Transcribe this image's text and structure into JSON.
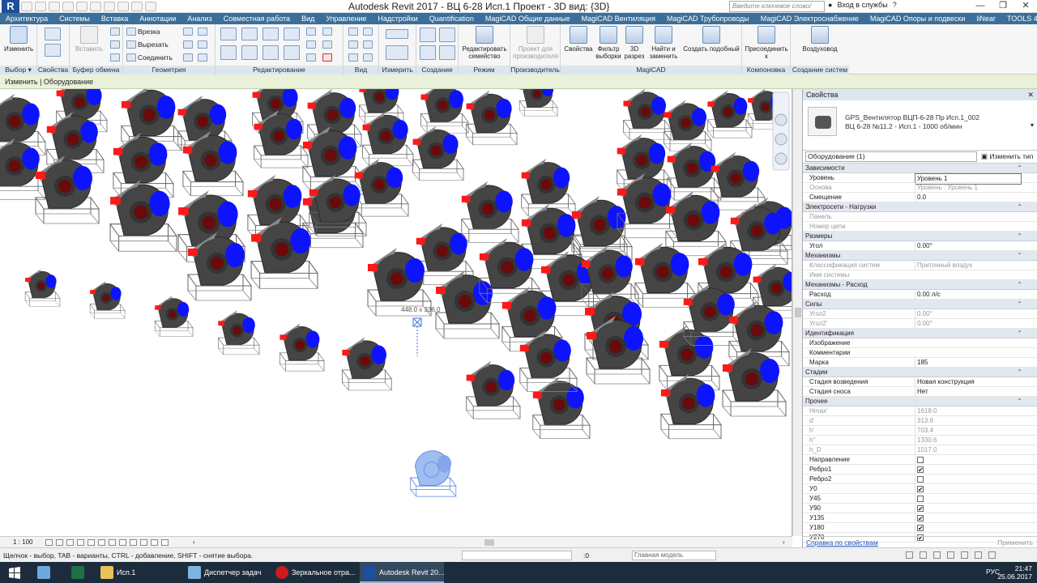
{
  "titlebar": {
    "app_title": "Autodesk Revit 2017 -    ВЦ 6-28 Исп.1  Проект - 3D вид: {3D}",
    "search_placeholder": "Введите ключевое слово/фразу",
    "signin": "Вход в службы",
    "help": "?"
  },
  "tabs": [
    "Архитектура",
    "Системы",
    "Вставка",
    "Аннотации",
    "Анализ",
    "Совместная работа",
    "Вид",
    "Управление",
    "Надстройки",
    "Quantification",
    "MagiCAD Общие данные",
    "MagiCAD Вентиляция",
    "MagiCAD Трубопроводы",
    "MagiCAD Электроснабжение",
    "MagiCAD Опоры и подвески",
    "liNear",
    "TOOLS 4 BIM"
  ],
  "ribbon": {
    "select_label": "Изменить",
    "props_label": "Свойства",
    "paste_label": "Вставить",
    "vrezka": "Врезка",
    "vyrezat": "Вырезать",
    "soedinit": "Соединить",
    "edit_family": "Редактировать семейство",
    "proj_for_prod": "Проект для производителя",
    "m_props": "Свойства",
    "m_filter": "Фильтр выборки",
    "m_3d": "3D разрез",
    "m_find": "Найти и заменить",
    "m_similar": "Создать подобный",
    "m_join": "Присоединить к",
    "m_duct": "Воздуховод",
    "groups": {
      "select": "Выбор ▾",
      "props": "Свойства",
      "clipboard": "Буфер обмена",
      "geometry": "Геометрия",
      "modify": "Редактирование",
      "view": "Вид",
      "measure": "Измерить",
      "create": "Создание",
      "mode": "Режим",
      "producer": "Производитель",
      "magicad": "MagiCAD",
      "layout": "Компоновка",
      "syscreate": "Создание систем"
    }
  },
  "option_bar": "Изменить | Оборудование",
  "viewport": {
    "temp_dim": "448.0 x 336.0",
    "scale": "1 : 100"
  },
  "properties": {
    "title": "Свойства",
    "type_line1": "GPS_Вентилятор ВЦП-6-28 Пр Исп.1_002",
    "type_line2": "ВЦ 6-28 №11.2 - Исп.1 - 1000 об/мин",
    "filter": "Оборудование (1)",
    "edit_type": "Изменить тип",
    "rows": [
      {
        "type": "group",
        "name": "Зависимости"
      },
      {
        "name": "Уровень",
        "value": "Уровень 1"
      },
      {
        "name": "Основа",
        "value": "Уровень : Уровень 1",
        "ro": true
      },
      {
        "name": "Смещение",
        "value": "0.0"
      },
      {
        "type": "group",
        "name": "Электросети - Нагрузки"
      },
      {
        "name": "Панель",
        "value": "",
        "ro": true
      },
      {
        "name": "Номер цепи",
        "value": "",
        "ro": true
      },
      {
        "type": "group",
        "name": "Размеры"
      },
      {
        "name": "Угол",
        "value": "0.00°"
      },
      {
        "type": "group",
        "name": "Механизмы"
      },
      {
        "name": "Классификация систем",
        "value": "Приточный воздух",
        "ro": true
      },
      {
        "name": "Имя системы",
        "value": "",
        "ro": true
      },
      {
        "type": "group",
        "name": "Механизмы - Расход"
      },
      {
        "name": "Расход",
        "value": "0.00 л/с"
      },
      {
        "type": "group",
        "name": "Силы"
      },
      {
        "name": "Угол2",
        "value": "0.00°",
        "ro": true
      },
      {
        "name": "Угол2'",
        "value": "0.00°",
        "ro": true
      },
      {
        "type": "group",
        "name": "Идентификация"
      },
      {
        "name": "Изображение",
        "value": ""
      },
      {
        "name": "Комментарии",
        "value": ""
      },
      {
        "name": "Марка",
        "value": "185"
      },
      {
        "type": "group",
        "name": "Стадии"
      },
      {
        "name": "Стадия возведения",
        "value": "Новая конструкция"
      },
      {
        "name": "Стадия сноса",
        "value": "Нет"
      },
      {
        "type": "group",
        "name": "Прочее"
      },
      {
        "name": "Hmax'",
        "value": "1618.0",
        "ro": true
      },
      {
        "name": "d'",
        "value": "313.6",
        "ro": true
      },
      {
        "name": "h'",
        "value": "703.4",
        "ro": true
      },
      {
        "name": "h''",
        "value": "1330.6",
        "ro": true
      },
      {
        "name": "h_D",
        "value": "1017.0",
        "ro": true
      },
      {
        "name": "Направление",
        "check": false
      },
      {
        "name": "Ребро1",
        "check": true
      },
      {
        "name": "Ребро2",
        "check": false
      },
      {
        "name": "У0",
        "check": true
      },
      {
        "name": "У45",
        "check": false
      },
      {
        "name": "У90",
        "check": true
      },
      {
        "name": "У135",
        "check": true
      },
      {
        "name": "У180",
        "check": true
      },
      {
        "name": "У270",
        "check": true
      }
    ],
    "help_link": "Справка по свойствам",
    "apply": "Применить"
  },
  "statusbar": {
    "hint": "Щелчок - выбор, TAB - варианты, CTRL - добавление, SHIFT - снятие выбора.",
    "zero": ":0",
    "model": "Главная модель"
  },
  "taskbar": {
    "items": [
      "Исп.1",
      "Диспетчер задач",
      "Зеркальное отра...",
      "Autodesk Revit 20..."
    ],
    "lang": "РУС",
    "time": "21:47",
    "date": "25.06.2017"
  },
  "colors": {
    "ribbon_tab_bg": "#3b6f99",
    "option_bar": "#e9f1d9",
    "fan_body": "#4a4a4a",
    "fan_motor": "#1010ff",
    "fan_flange": "#ff1a1a",
    "selected": "#3a6fd8"
  }
}
